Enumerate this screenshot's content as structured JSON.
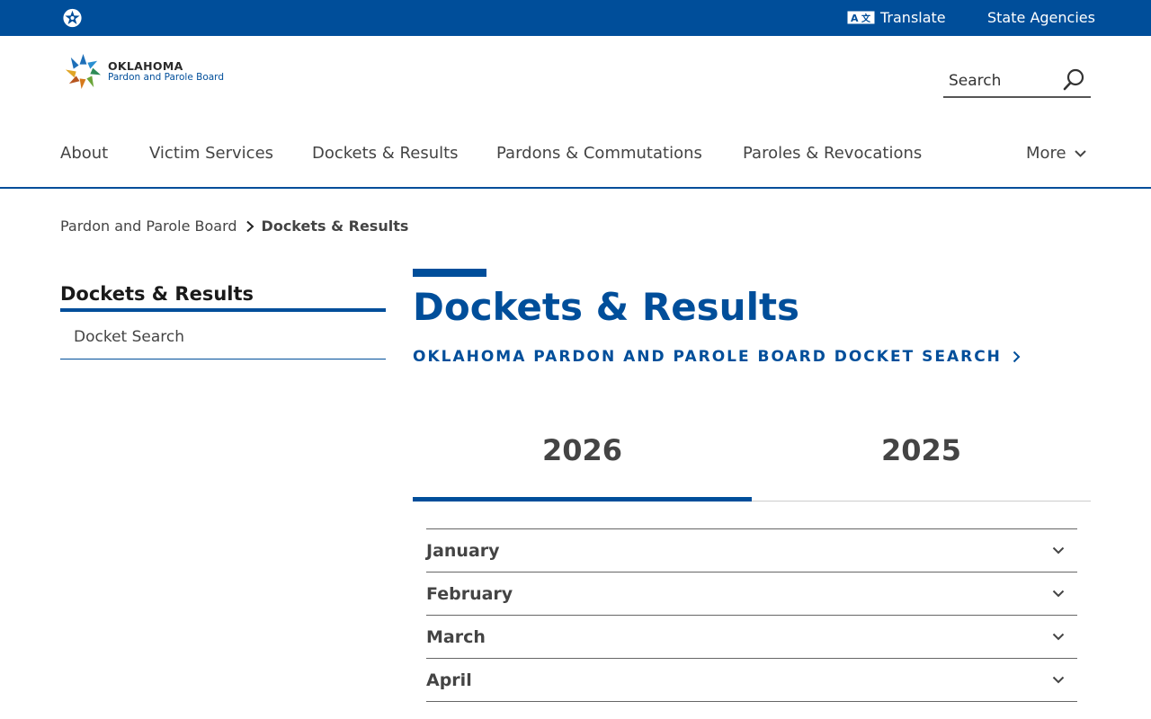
{
  "topbar": {
    "translate_label": "Translate",
    "agencies_label": "State Agencies",
    "state_logo_icon": "oklahoma-star-icon",
    "translate_icon": "translate-icon"
  },
  "header": {
    "logo_line1": "OKLAHOMA",
    "logo_line2": "Pardon and Parole Board",
    "search_placeholder": "Search",
    "search_icon": "search-icon"
  },
  "nav": {
    "items": [
      "About",
      "Victim Services",
      "Dockets & Results",
      "Pardons & Commutations",
      "Paroles & Revocations"
    ],
    "more_label": "More"
  },
  "breadcrumb": {
    "parent": "Pardon and Parole Board",
    "current": "Dockets & Results"
  },
  "sidenav": {
    "title": "Dockets & Results",
    "items": [
      "Docket Search"
    ]
  },
  "main": {
    "title": "Dockets & Results",
    "docket_link": "Oklahoma Pardon and Parole Board Docket Search"
  },
  "tabs": {
    "items": [
      "2026",
      "2025"
    ],
    "active": "2026"
  },
  "accordion": {
    "months": [
      "January",
      "February",
      "March",
      "April"
    ]
  },
  "colors": {
    "brand_blue": "#004e9a",
    "text": "#444444"
  }
}
